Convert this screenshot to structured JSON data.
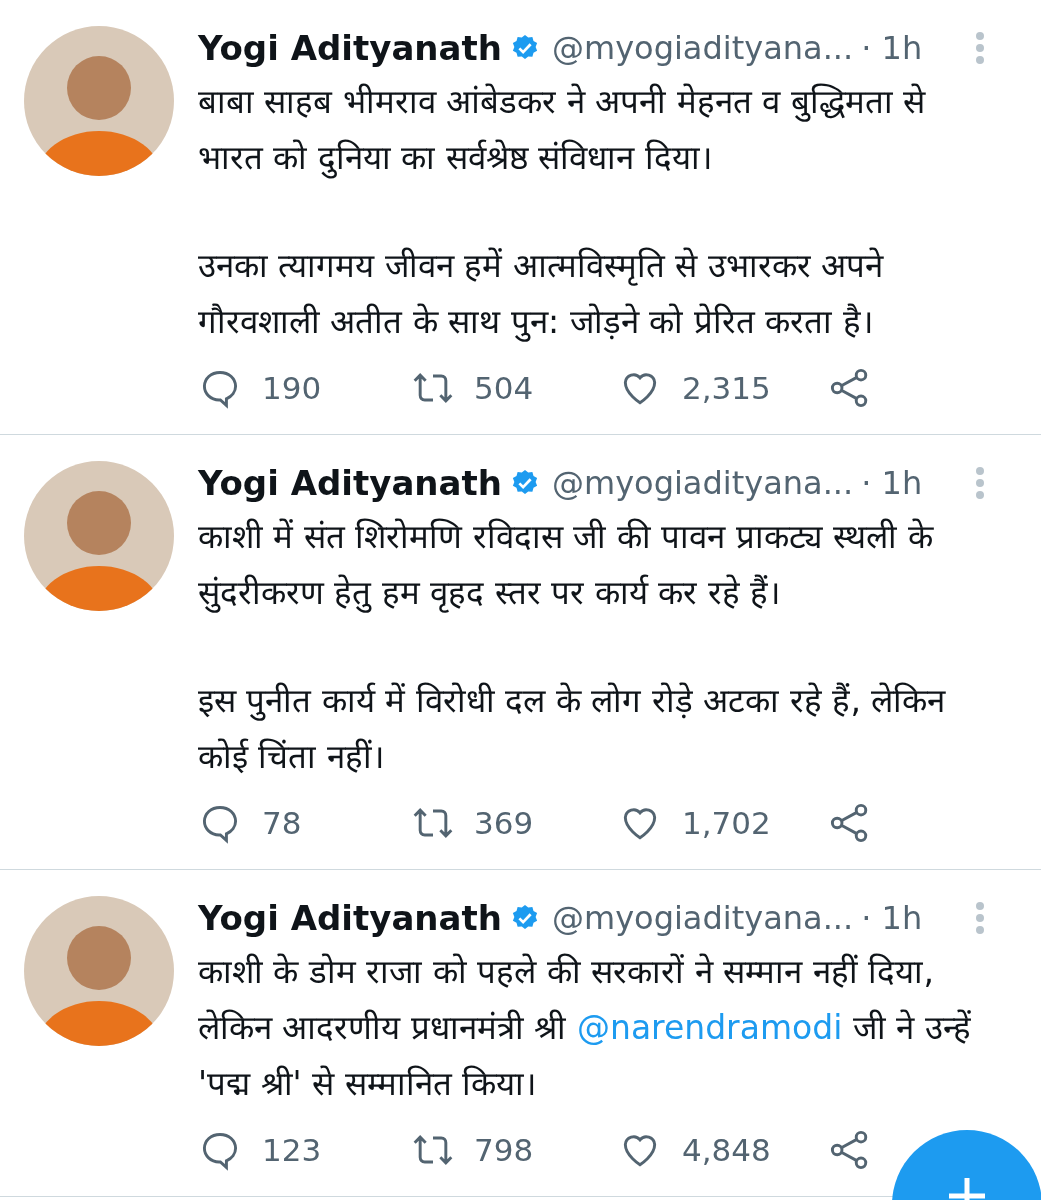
{
  "tweets": [
    {
      "name": "Yogi Adityanath",
      "verified": true,
      "handle": "@myogiadityana...",
      "time": "· 1h",
      "paragraphs": [
        [
          {
            "kind": "text",
            "text": "बाबा साहब भीमराव आंबेडकर ने अपनी मेहनत व बुद्धिमता से भारत को दुनिया का सर्वश्रेष्ठ संविधान दिया।"
          }
        ],
        [
          {
            "kind": "text",
            "text": "उनका त्यागमय जीवन हमें आत्मविस्मृति से उभारकर अपने गौरवशाली अतीत के साथ पुन: जोड़ने को प्रेरित करता है।"
          }
        ]
      ],
      "replies": "190",
      "retweets": "504",
      "likes": "2,315"
    },
    {
      "name": "Yogi Adityanath",
      "verified": true,
      "handle": "@myogiadityana...",
      "time": "· 1h",
      "paragraphs": [
        [
          {
            "kind": "text",
            "text": "काशी में संत शिरोमणि रविदास जी की पावन प्राकट्य स्थली के सुंदरीकरण हेतु हम वृहद स्तर पर कार्य कर रहे हैं।"
          }
        ],
        [
          {
            "kind": "text",
            "text": "इस पुनीत कार्य में विरोधी दल के लोग रोड़े अटका रहे हैं, लेकिन कोई चिंता नहीं।"
          }
        ]
      ],
      "replies": "78",
      "retweets": "369",
      "likes": "1,702"
    },
    {
      "name": "Yogi Adityanath",
      "verified": true,
      "handle": "@myogiadityana...",
      "time": "· 1h",
      "paragraphs": [
        [
          {
            "kind": "text",
            "text": "काशी के डोम राजा को पहले की सरकारों ने सम्मान नहीं दिया, लेकिन आदरणीय प्रधानमंत्री श्री "
          },
          {
            "kind": "mention",
            "text": "@narendramodi"
          },
          {
            "kind": "text",
            "text": " जी ने उन्हें 'पद्म श्री' से सम्मानित किया।"
          }
        ]
      ],
      "replies": "123",
      "retweets": "798",
      "likes": "4,848"
    }
  ]
}
